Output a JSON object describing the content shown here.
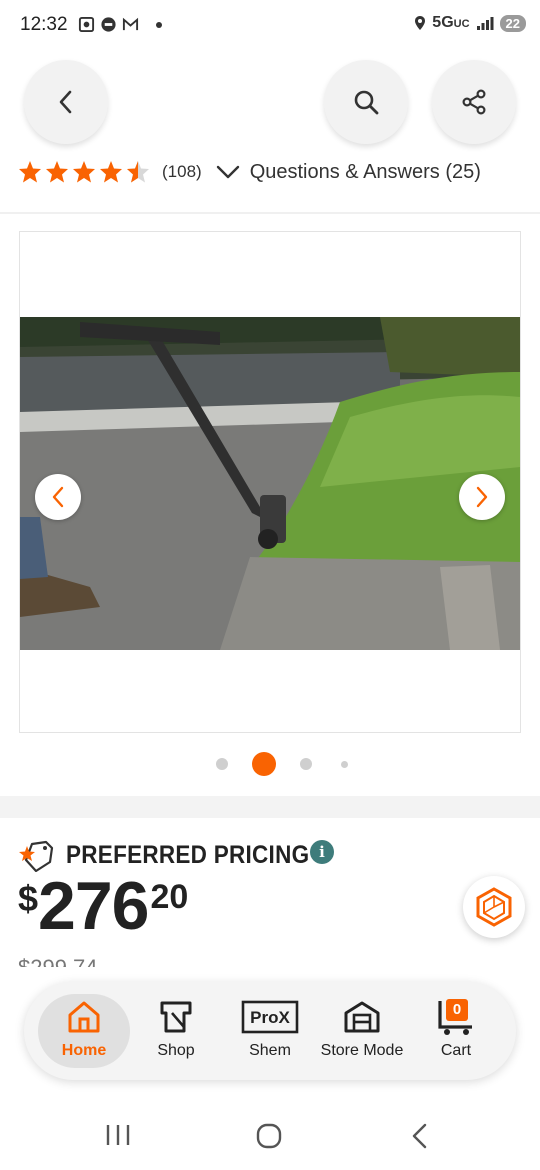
{
  "status_bar": {
    "time": "12:32",
    "network": "5G",
    "network_suffix": "UC",
    "battery": "22"
  },
  "header": {
    "back_icon": "chevron-left-icon",
    "search_icon": "search-icon",
    "share_icon": "share-icon"
  },
  "rating": {
    "stars": 4.5,
    "count": "(108)",
    "qa_label": "Questions & Answers (25)",
    "star_color": "#f96302"
  },
  "carousel": {
    "total": 4,
    "active_index": 1,
    "active_color": "#f96302",
    "arrow_color": "#f96302"
  },
  "pricing": {
    "label": "PREFERRED PRICING",
    "info_icon": "i",
    "dollar": "$",
    "price_main": "276",
    "price_cents": "20",
    "was_price": "$299.74"
  },
  "bottom_nav": {
    "items": [
      {
        "label": "Home",
        "icon": "home-icon",
        "active": true
      },
      {
        "label": "Shop",
        "icon": "shop-icon"
      },
      {
        "label": "Shem",
        "icon": "prox-icon",
        "icon_text": "ProX"
      },
      {
        "label": "Store Mode",
        "icon": "store-icon"
      },
      {
        "label": "Cart",
        "icon": "cart-icon",
        "badge": "0"
      }
    ]
  },
  "colors": {
    "brand_orange": "#f96302",
    "teal": "#3e7c7b"
  }
}
